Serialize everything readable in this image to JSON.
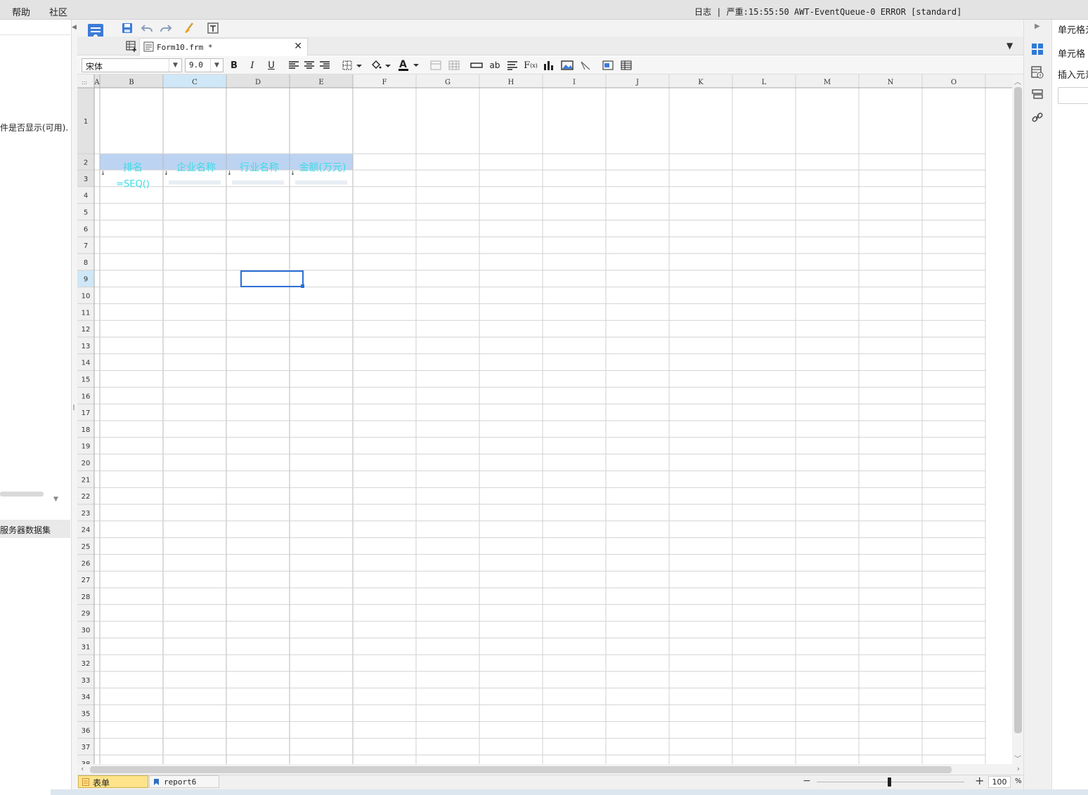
{
  "menubar": {
    "items": [
      "帮助",
      "社区"
    ],
    "log": "日志 | 严重:15:55:50 AWT-EventQueue-0 ERROR [standard]"
  },
  "left_panel": {
    "condition_text": "件是否显示(可用).",
    "dataset_label": "服务器数据集"
  },
  "tab": {
    "file_name": "Form10.frm *"
  },
  "format": {
    "font_name": "宋体",
    "font_size": "9.0"
  },
  "grid": {
    "columns": [
      "A",
      "B",
      "C",
      "D",
      "E",
      "F",
      "G",
      "H",
      "I",
      "J",
      "K",
      "L",
      "M",
      "N",
      "O"
    ],
    "selected_column": "C",
    "selected_row": 9,
    "header_cells": [
      "排名",
      "企业名称",
      "行业名称",
      "金额(万元)"
    ],
    "formula_cell": "=SEQ()",
    "header_row_color": "#bcd3f2",
    "header_text_color": "#3ddbe6",
    "selection_color": "#2b6fd6",
    "visible_rows": 38
  },
  "sheets": [
    {
      "label": "表单",
      "icon": "form-sheet-icon"
    },
    {
      "label": "report6",
      "icon": "report-sheet-icon"
    }
  ],
  "zoom": {
    "value": "100",
    "unit": "%",
    "minus": "−",
    "plus": "+"
  },
  "right_panel": {
    "title": "单元格元",
    "cell_label": "单元格",
    "insert_label": "插入元素"
  }
}
